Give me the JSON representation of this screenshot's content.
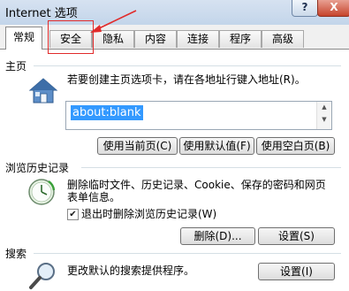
{
  "window": {
    "title": "Internet 选项",
    "help_label": "?",
    "close_label": "X"
  },
  "tabs": [
    {
      "label": "常规",
      "active": true
    },
    {
      "label": "安全",
      "active": false
    },
    {
      "label": "隐私",
      "active": false
    },
    {
      "label": "内容",
      "active": false
    },
    {
      "label": "连接",
      "active": false
    },
    {
      "label": "程序",
      "active": false
    },
    {
      "label": "高级",
      "active": false
    }
  ],
  "homepage": {
    "section_label": "主页",
    "description": "若要创建主页选项卡，请在各地址行键入地址(R)。",
    "value": "about:blank",
    "buttons": {
      "use_current": "使用当前页(C)",
      "use_default": "使用默认值(F)",
      "use_blank": "使用空白页(B)"
    },
    "icon": "house-icon"
  },
  "history": {
    "section_label": "浏览历史记录",
    "description_line1": "删除临时文件、历史记录、Cookie、保存的密码和网页",
    "description_line2": "表单信息。",
    "checkbox_label": "退出时删除浏览历史记录(W)",
    "checkbox_checked": true,
    "delete_button": "删除(D)...",
    "settings_button": "设置(S)",
    "icon": "history-clock-icon"
  },
  "search": {
    "section_label": "搜索",
    "description": "更改默认的搜索提供程序。",
    "settings_button": "设置(I)",
    "icon": "magnifier-icon"
  },
  "annotation": {
    "color": "#e12b2b"
  }
}
